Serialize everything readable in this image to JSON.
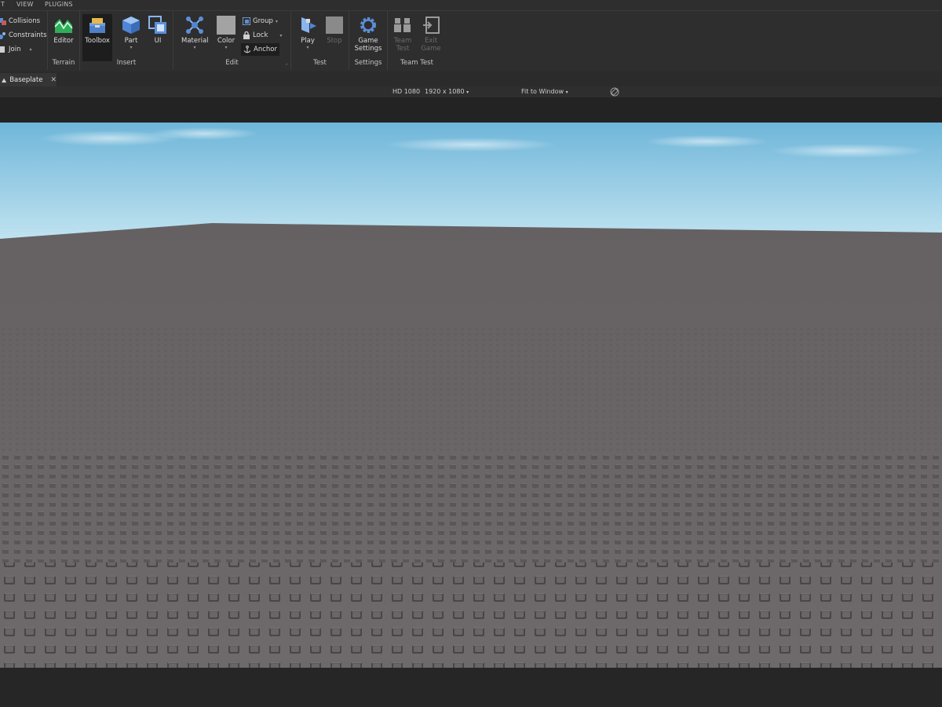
{
  "menubar": {
    "items": [
      "T",
      "VIEW",
      "PLUGINS"
    ]
  },
  "ribbon": {
    "physics": {
      "collisions": "Collisions",
      "constraints": "Constraints",
      "join": "Join"
    },
    "terrain": {
      "editor": "Editor",
      "group_label": "Terrain"
    },
    "insert": {
      "toolbox": "Toolbox",
      "part": "Part",
      "ui": "UI",
      "group_label": "Insert"
    },
    "edit": {
      "material": "Material",
      "color": "Color",
      "group": "Group",
      "lock": "Lock",
      "anchor": "Anchor",
      "group_label": "Edit"
    },
    "test": {
      "play": "Play",
      "stop": "Stop",
      "group_label": "Test"
    },
    "settings": {
      "game_settings_1": "Game",
      "game_settings_2": "Settings",
      "group_label": "Settings"
    },
    "team_test": {
      "team_test_1": "Team",
      "team_test_2": "Test",
      "exit_game_1": "Exit",
      "exit_game_2": "Game",
      "group_label": "Team Test"
    }
  },
  "tabs": [
    {
      "label": "Baseplate"
    }
  ],
  "device_bar": {
    "device": "HD 1080",
    "resolution": "1920 x 1080",
    "fit": "Fit to Window"
  },
  "colors": {
    "sky_top": "#7fc0dc",
    "sky_bottom": "#bfe4f0",
    "baseplate": "#6b6769",
    "stud": "#4e4a4c",
    "panel": "#2e2e2e"
  },
  "icons": [
    "collisions-icon",
    "constraints-icon",
    "join-icon",
    "terrain-editor-icon",
    "toolbox-icon",
    "part-icon",
    "ui-icon",
    "material-icon",
    "color-icon",
    "group-icon",
    "lock-icon",
    "anchor-icon",
    "play-icon",
    "stop-icon",
    "game-settings-icon",
    "team-test-icon",
    "exit-game-icon",
    "close-icon",
    "rotate-device-icon"
  ]
}
